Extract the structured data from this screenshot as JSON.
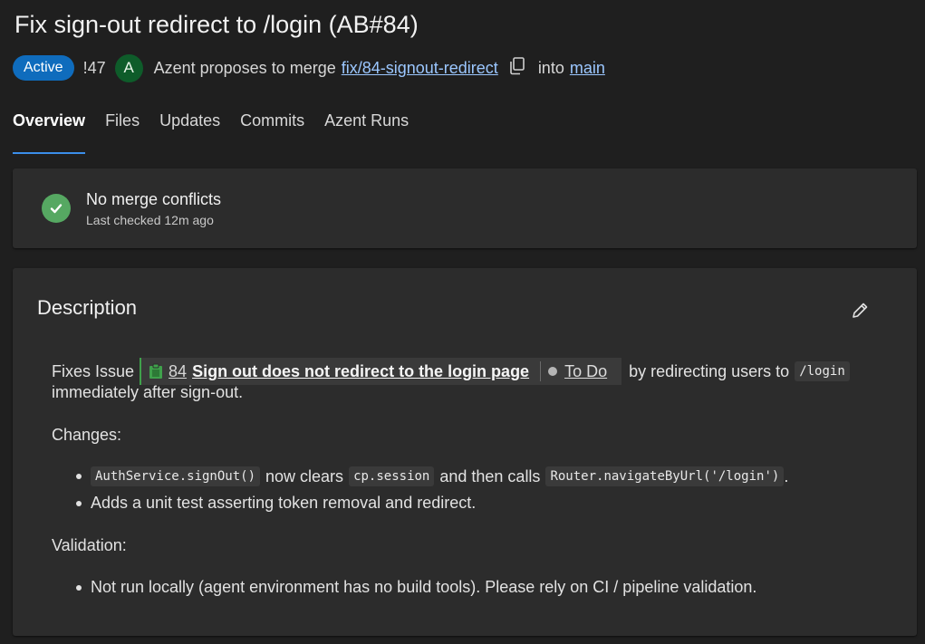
{
  "pr": {
    "title": "Fix sign-out redirect to /login (AB#84)",
    "status": "Active",
    "number": "!47",
    "avatar_initial": "A",
    "proposal_text": "Azent proposes to merge",
    "source_branch": "fix/84-signout-redirect",
    "into_text": "into",
    "target_branch": "main"
  },
  "tabs": [
    "Overview",
    "Files",
    "Updates",
    "Commits",
    "Azent Runs"
  ],
  "merge_status": {
    "title": "No merge conflicts",
    "subtitle": "Last checked 12m ago"
  },
  "description": {
    "heading": "Description",
    "fixes_prefix": "Fixes Issue",
    "issue": {
      "number": "84",
      "title": "Sign out does not redirect to the login page",
      "state": "To Do"
    },
    "fixes_suffix": "by redirecting users to",
    "fixes_code": "/login",
    "fixes_line2": "immediately after sign-out.",
    "changes_label": "Changes:",
    "change1": {
      "code1": "AuthService.signOut()",
      "text1": "now clears",
      "code2": "cp.session",
      "text2": "and then calls",
      "code3": "Router.navigateByUrl('/login')",
      "text3": "."
    },
    "change2": "Adds a unit test asserting token removal and redirect.",
    "validation_label": "Validation:",
    "validation1": "Not run locally (agent environment has no build tools). Please rely on CI / pipeline validation."
  },
  "colors": {
    "badge": "#0f6cbd",
    "link": "#9bc7ff",
    "success": "#56a862",
    "tab_underline": "#3b8eea"
  }
}
